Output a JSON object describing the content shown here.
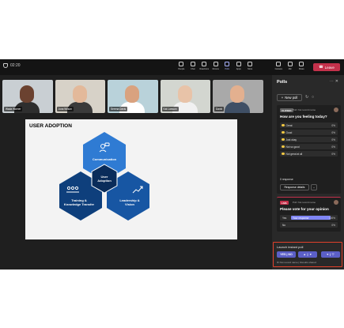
{
  "meeting": {
    "timer": "02:20"
  },
  "toolbar": {
    "items": [
      {
        "label": "People",
        "icon": "people-icon"
      },
      {
        "label": "Chat",
        "icon": "chat-icon"
      },
      {
        "label": "Reactions",
        "icon": "reactions-icon"
      },
      {
        "label": "Rooms",
        "icon": "rooms-icon"
      },
      {
        "label": "Polls",
        "icon": "polls-icon",
        "active": true
      },
      {
        "label": "Apps",
        "icon": "apps-icon"
      },
      {
        "label": "More",
        "icon": "more-icon"
      }
    ],
    "devices": [
      {
        "label": "Camera",
        "icon": "camera-icon"
      },
      {
        "label": "Mic",
        "icon": "mic-icon"
      },
      {
        "label": "Share",
        "icon": "share-icon"
      }
    ],
    "leave_label": "Leave"
  },
  "participants": [
    {
      "name": "Wada Warner",
      "skin": "#6b4230",
      "bg": "#c9cfd3",
      "shirt": "#2e2e2e"
    },
    {
      "name": "Juna Wilson",
      "skin": "#e3b99a",
      "bg": "#d7d2c8",
      "shirt": "#3a3a3a"
    },
    {
      "name": "Serena Davis",
      "skin": "#d9a27f",
      "bg": "#b9d2da",
      "shirt": "#ffffff"
    },
    {
      "name": "Kat Larsson",
      "skin": "#e8c3a8",
      "bg": "#d3d6d0",
      "shirt": "#f1f1f1"
    },
    {
      "name": "David",
      "skin": "#e3b08f",
      "bg": "#a9a9a9",
      "shirt": "#3f4f65"
    }
  ],
  "slide": {
    "title": "USER ADOPTION",
    "nodes": {
      "communication": "Communication",
      "center_line1": "User",
      "center_line2": "Adoption",
      "training_line1": "Training &",
      "training_line2": "Knowledge Transfer",
      "leadership_line1": "Leadership &",
      "leadership_line2": "Vision"
    }
  },
  "polls_pane": {
    "title": "Polls",
    "new_poll": "New poll",
    "poll1": {
      "badge": "CLOSED",
      "meta": "Poll: Not record name",
      "question": "How are you feeling today?",
      "options": [
        {
          "label": "Great",
          "pct": "0%"
        },
        {
          "label": "Good",
          "pct": "0%"
        },
        {
          "label": "Just okay",
          "pct": "0%"
        },
        {
          "label": "Not so good",
          "pct": "0%"
        },
        {
          "label": "Not great at all",
          "pct": "0%"
        }
      ],
      "responses": "0 response",
      "details_label": "Response details"
    },
    "poll2": {
      "badge": "LIVE",
      "meta": "Poll: Not record name",
      "question": "Please vote for your opinion",
      "options": [
        {
          "label": "Yes",
          "fill_label": "Your response",
          "pct": "100%",
          "fill": 1.0
        },
        {
          "label": "No",
          "pct": "0%",
          "fill": 0.0
        }
      ]
    },
    "launch": {
      "title": "Launch instant poll",
      "btn_yes_no": "YES | NO",
      "note": "Not record name | Results shared"
    }
  },
  "colors": {
    "accent": "#5b5fc7",
    "leave": "#c4314b",
    "highlight_box": "#e0402a",
    "hex_light": "#2f7bd3",
    "hex_dark": "#0e3f7c"
  }
}
